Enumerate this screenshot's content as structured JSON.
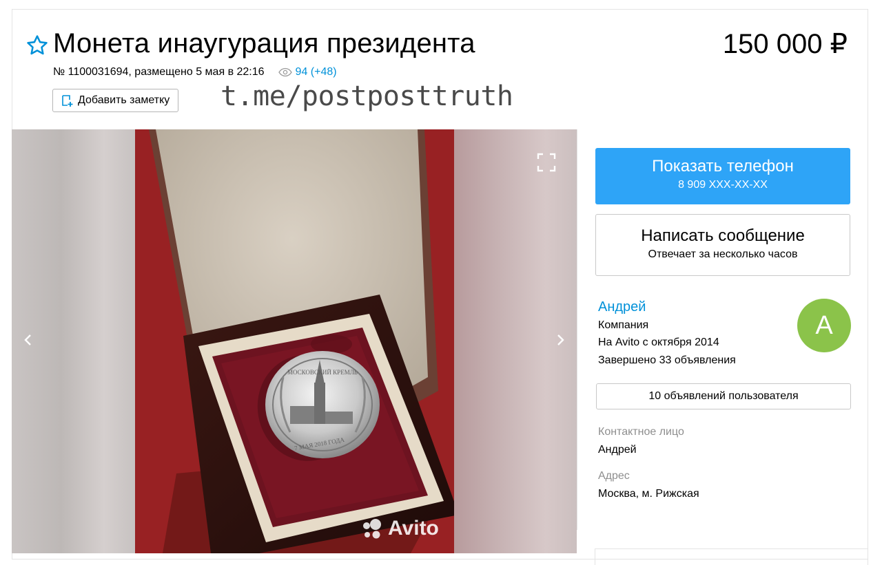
{
  "listing": {
    "title": "Монета инаугурация президента",
    "price": "150 000 ₽",
    "number_and_date": "№ 1100031694, размещено 5 мая в 22:16",
    "views": "94 (+48)",
    "add_note_label": "Добавить заметку"
  },
  "watermark_text": "t.me/postposttruth",
  "gallery": {
    "photo_watermark": "Avito",
    "coin_text_top": "МОСКОВСКИЙ КРЕМЛЬ",
    "coin_text_bottom": "7 МАЯ 2018 ГОДА"
  },
  "contact": {
    "show_phone_label": "Показать телефон",
    "phone_masked": "8 909 XXX-XX-XX",
    "write_message_label": "Написать сообщение",
    "response_time": "Отвечает за несколько часов"
  },
  "seller": {
    "name": "Андрей",
    "type": "Компания",
    "since": "На Avito с октября 2014",
    "completed": "Завершено 33 объявления",
    "avatar_letter": "А",
    "listings_button": "10 объявлений пользователя",
    "contact_person_label": "Контактное лицо",
    "contact_person": "Андрей",
    "address_label": "Адрес",
    "address": "Москва, м. Рижская"
  },
  "colors": {
    "accent_blue": "#2ea4f7",
    "link_blue": "#0091d9",
    "avatar_green": "#8bc34a"
  }
}
